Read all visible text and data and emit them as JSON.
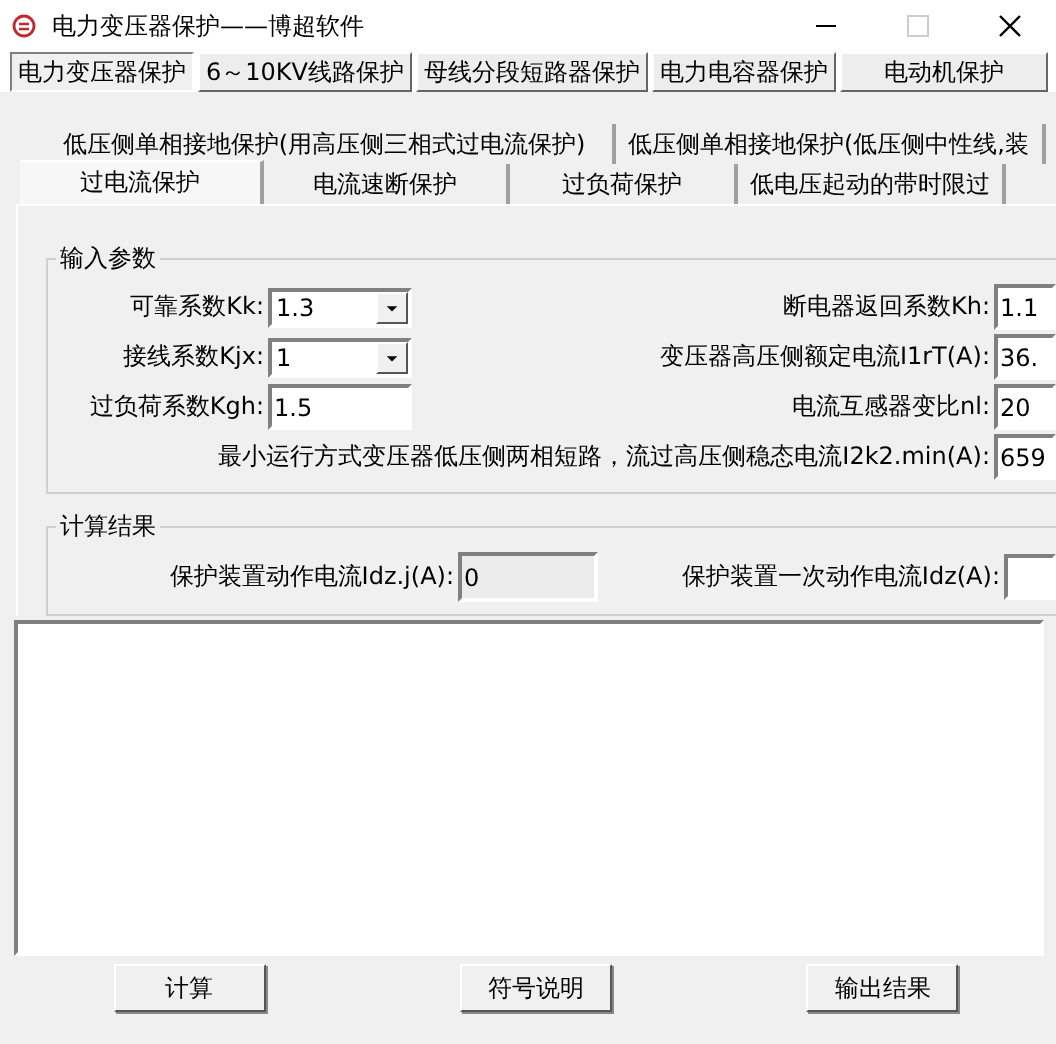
{
  "window": {
    "title": "电力变压器保护——博超软件"
  },
  "main_tabs": [
    {
      "label": "电力变压器保护",
      "selected": true
    },
    {
      "label": "6～10KV线路保护",
      "selected": false
    },
    {
      "label": "母线分段短路器保护",
      "selected": false
    },
    {
      "label": "电力电容器保护",
      "selected": false
    },
    {
      "label": "电动机保护",
      "selected": false
    }
  ],
  "sub_tabs_back": [
    {
      "label": "低压侧单相接地保护(用高压侧三相式过电流保护)",
      "selected": false
    },
    {
      "label": "低压侧单相接地保护(低压侧中性线,装",
      "selected": false
    }
  ],
  "sub_tabs_front": [
    {
      "label": "过电流保护",
      "selected": true
    },
    {
      "label": "电流速断保护",
      "selected": false
    },
    {
      "label": "过负荷保护",
      "selected": false
    },
    {
      "label": "低电压起动的带时限过",
      "selected": false
    }
  ],
  "input_group": {
    "title": "输入参数",
    "rows": [
      {
        "left": {
          "label": "可靠系数Kk:",
          "kind": "combo",
          "value": "1.3"
        },
        "right": {
          "label": "断电器返回系数Kh:",
          "kind": "text",
          "value": "1.1"
        }
      },
      {
        "left": {
          "label": "接线系数Kjx:",
          "kind": "combo",
          "value": "1"
        },
        "right": {
          "label": "变压器高压侧额定电流I1rT(A):",
          "kind": "text",
          "value": "36."
        }
      },
      {
        "left": {
          "label": "过负荷系数Kgh:",
          "kind": "text",
          "value": "1.5"
        },
        "right": {
          "label": "电流互感器变比nl:",
          "kind": "text",
          "value": "20"
        }
      },
      {
        "right": {
          "label": "最小运行方式变压器低压侧两相短路，流过高压侧稳态电流I2k2.min(A):",
          "kind": "text",
          "value": "659"
        }
      }
    ]
  },
  "result_group": {
    "title": "计算结果",
    "fields": [
      {
        "label": "保护装置动作电流Idz.j(A):",
        "kind": "readonly",
        "value": "0"
      },
      {
        "label": "保护装置一次动作电流Idz(A):",
        "kind": "text"
      }
    ]
  },
  "buttons": [
    {
      "label": "计算"
    },
    {
      "label": "符号说明"
    },
    {
      "label": "输出结果"
    }
  ]
}
